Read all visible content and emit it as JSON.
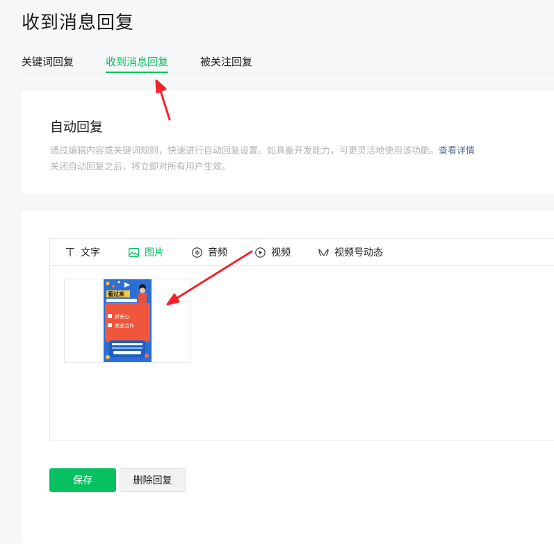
{
  "page": {
    "title": "收到消息回复"
  },
  "tabs": [
    {
      "label": "关键词回复",
      "active": false
    },
    {
      "label": "收到消息回复",
      "active": true
    },
    {
      "label": "被关注回复",
      "active": false
    }
  ],
  "intro": {
    "heading": "自动回复",
    "desc1": "通过编辑内容或关键词规则，快速进行自动回复设置。如具备开发能力，可更灵活地使用该功能。",
    "details_link": "查看详情",
    "desc2": "关闭自动回复之后，将立即对所有用户生效。"
  },
  "editor": {
    "tools": [
      {
        "label": "文字",
        "icon": "text-icon",
        "active": false
      },
      {
        "label": "图片",
        "icon": "image-icon",
        "active": true
      },
      {
        "label": "音频",
        "icon": "audio-icon",
        "active": false
      },
      {
        "label": "视频",
        "icon": "video-icon",
        "active": false
      },
      {
        "label": "视频号动态",
        "icon": "channels-icon",
        "active": false
      }
    ],
    "poster": {
      "headline": "看过来",
      "item1": "好安心",
      "item2": "商业合作"
    }
  },
  "actions": {
    "save": "保存",
    "delete": "删除回复"
  },
  "colors": {
    "accent": "#07c160",
    "link": "#576b95",
    "annotation_arrow": "#f5222d"
  }
}
